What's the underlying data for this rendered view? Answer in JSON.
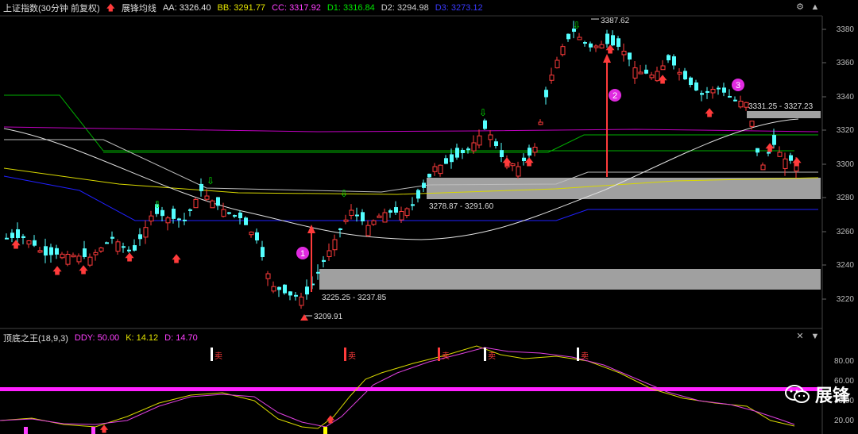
{
  "header": {
    "title": "上证指数(30分钟 前复权)",
    "indicator": "展锋均线",
    "values": [
      {
        "label": "AA: 3326.40",
        "color": "#e6e6e6"
      },
      {
        "label": "BB: 3291.77",
        "color": "#e6e600"
      },
      {
        "label": "CC: 3317.92",
        "color": "#ff40ff"
      },
      {
        "label": "D1: 3316.84",
        "color": "#00e600"
      },
      {
        "label": "D2: 3294.98",
        "color": "#cfcfcf"
      },
      {
        "label": "D3: 3273.12",
        "color": "#3a3aff"
      }
    ]
  },
  "kdj_header": {
    "title": "顶底之王(18,9,3)",
    "values": [
      {
        "label": "DDY: 50.00",
        "color": "#ff40ff"
      },
      {
        "label": "K: 14.12",
        "color": "#e6e600"
      },
      {
        "label": "D: 14.70",
        "color": "#ff40ff"
      }
    ]
  },
  "price_axis": [
    "3380",
    "3360",
    "3340",
    "3320",
    "3300",
    "3280",
    "3260",
    "3240",
    "3220"
  ],
  "kdj_axis": [
    "80.00",
    "60.00",
    "40.00",
    "20.00"
  ],
  "annotations": {
    "high": "3387.62",
    "low": "3209.91",
    "zone_top": "3331.25 - 3327.23",
    "zone_mid": "3278.87 - 3291.60",
    "zone_low": "3225.25 - 3237.85",
    "markers": [
      "1",
      "2",
      "3"
    ],
    "sell_label": "卖"
  },
  "watermark": "展锋",
  "colors": {
    "up": "#ff3b3b",
    "down": "#54ffff",
    "magenta": "#ff40ff",
    "zone": "#a0a0a0"
  }
}
